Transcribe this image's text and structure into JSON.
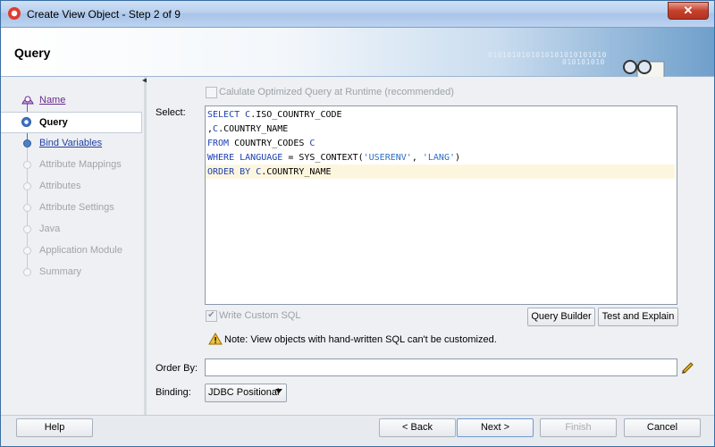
{
  "window": {
    "title": "Create View Object - Step 2 of 9",
    "close_label": "✕"
  },
  "banner": {
    "title": "Query",
    "binary_text_1": "0101010101010101010101010",
    "binary_text_2": "010101010"
  },
  "steps": [
    {
      "label": "Name",
      "state": "visited"
    },
    {
      "label": "Query",
      "state": "current"
    },
    {
      "label": "Bind Variables",
      "state": "visited"
    },
    {
      "label": "Attribute Mappings",
      "state": "disabled"
    },
    {
      "label": "Attributes",
      "state": "disabled"
    },
    {
      "label": "Attribute Settings",
      "state": "disabled"
    },
    {
      "label": "Java",
      "state": "disabled"
    },
    {
      "label": "Application Module",
      "state": "disabled"
    },
    {
      "label": "Summary",
      "state": "disabled"
    }
  ],
  "main": {
    "optimize_label": "Calulate Optimized Query at Runtime (recommended)",
    "select_label": "Select:",
    "sql_lines": [
      "SELECT C.ISO_COUNTRY_CODE",
      ",C.COUNTRY_NAME",
      "FROM COUNTRY_CODES C",
      "WHERE LANGUAGE = SYS_CONTEXT('USERENV', 'LANG')",
      "ORDER BY C.COUNTRY_NAME"
    ],
    "write_custom_sql_label": "Write Custom SQL",
    "query_builder_label": "Query Builder",
    "test_explain_label": "Test and Explain",
    "warning_text": "Note: View objects with hand-written SQL can't be customized.",
    "order_by_label": "Order By:",
    "order_by_value": "",
    "binding_label": "Binding:",
    "binding_value": "JDBC Positional"
  },
  "footer": {
    "help": "Help",
    "back": "< Back",
    "next": "Next >",
    "finish": "Finish",
    "cancel": "Cancel"
  },
  "colors": {
    "accent": "#3d74c4",
    "keyword": "#1d3fb0",
    "highlight_line": "#fdf6df"
  }
}
